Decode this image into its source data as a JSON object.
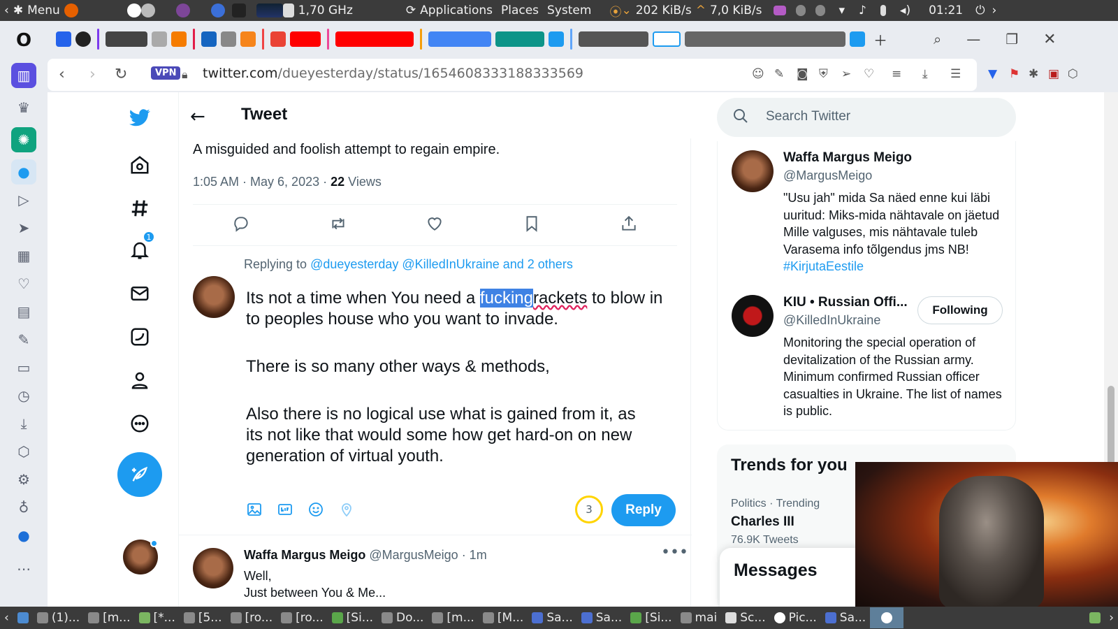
{
  "system_panel": {
    "menu_label": "Menu",
    "cpu_freq": "1,70 GHz",
    "menus": [
      "Applications",
      "Places",
      "System"
    ],
    "net_down": "202 KiB/s",
    "net_up": "7,0 KiB/s",
    "clock": "01:21"
  },
  "browser": {
    "vpn_label": "VPN",
    "url_host": "twitter.com",
    "url_path": "/dueyesterday/status/1654608333188333569"
  },
  "nav": {
    "notifications_badge": "1"
  },
  "tweet": {
    "header_title": "Tweet",
    "text": "A misguided and foolish attempt to regain empire.",
    "time": "1:05 AM · May 6, 2023 · ",
    "views_count": "22",
    "views_label": " Views"
  },
  "reply": {
    "replying_prefix": "Replying to ",
    "replying_links": "@dueyesterday @KilledInUkraine and 2 others",
    "draft_line1_a": "Its not a time when You need a ",
    "draft_selected": "fucking",
    "draft_misspelled": "rackets",
    "draft_line1_b": " to blow in to peoples house who you want to invade.",
    "draft_para2": "There is so many other ways & methods,",
    "draft_para3": "Also there is no logical use what is gained from it, as its not like that would some how get hard-on on new generation of virtual youth.",
    "char_count": "3",
    "reply_button": "Reply"
  },
  "next_tweet": {
    "name": "Waffa Margus Meigo",
    "handle": "@MargusMeigo",
    "time": " · 1m",
    "line1": "Well,",
    "line2": "Just between You & Me..."
  },
  "sidebar": {
    "search_placeholder": "Search Twitter",
    "people": [
      {
        "name": "Waffa Margus Meigo",
        "handle": "@MargusMeigo",
        "bio": "\"Usu jah\" mida Sa näed enne kui läbi uuritud: Miks-mida nähtavale on jäetud Mille valguses, mis nähtavale tuleb Varasema info tõlgendus jms NB! ",
        "bio_tag": "#KirjutaEestile"
      },
      {
        "name": "KIU • Russian Offi...",
        "handle": "@KilledInUkraine",
        "bio": "Monitoring the special operation of devitalization of the Russian army. Minimum confirmed Russian officer casualties in Ukraine. The list of names is public.",
        "follow_label": "Following"
      }
    ],
    "trends_title": "Trends for you",
    "trend": {
      "category": "Politics · Trending",
      "name": "Charles III",
      "count": "76.9K Tweets"
    },
    "messages_label": "Messages"
  },
  "taskbar": {
    "items": [
      "(1)...",
      "[m...",
      "[*...",
      "[5...",
      "[ro...",
      "[ro...",
      "[Si...",
      "Do...",
      "[m...",
      "[M...",
      "Sa...",
      "Sa...",
      "[Si...",
      "mai",
      "Sc...",
      "Pic...",
      "Sa..."
    ]
  },
  "colors": {
    "twitter_blue": "#1d9bf0",
    "selection": "#3f82e4",
    "panel": "#3b3b3b"
  }
}
